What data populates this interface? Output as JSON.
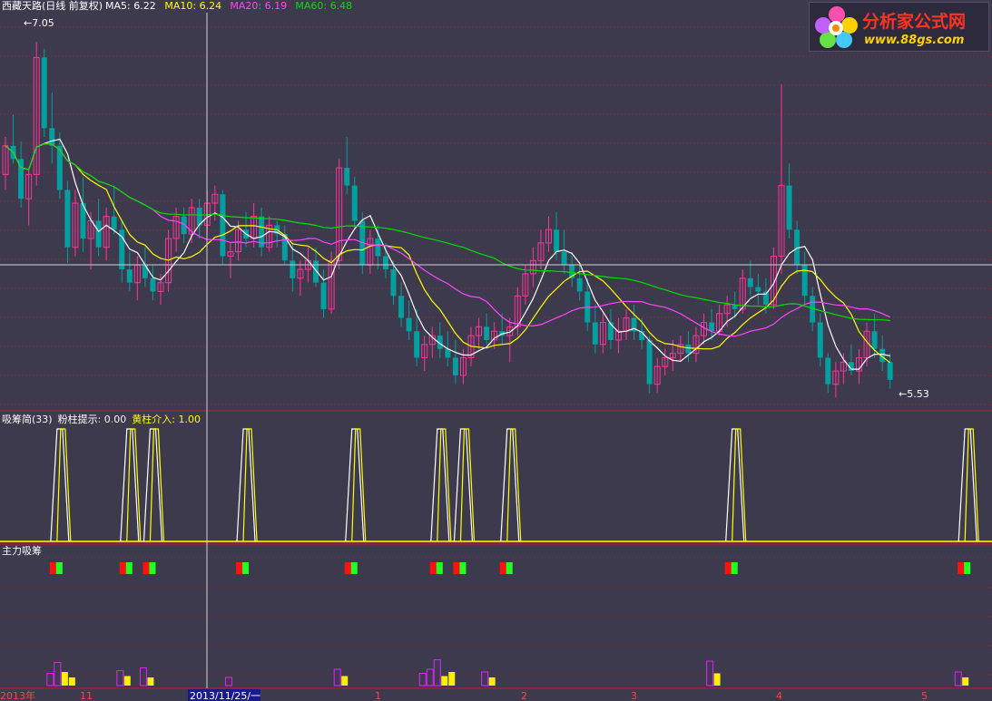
{
  "header": {
    "stock_name": "西藏天路",
    "adjust": "(日线 前复权)",
    "ma": [
      {
        "label": "MA5: ",
        "value": "6.22",
        "color": "#ffffff"
      },
      {
        "label": "MA10: ",
        "value": "6.24",
        "color": "#ffff00"
      },
      {
        "label": "MA20: ",
        "value": "6.19",
        "color": "#ff44ff"
      },
      {
        "label": "MA60: ",
        "value": "6.48",
        "color": "#00e000"
      }
    ]
  },
  "annotations": {
    "high": "7.05",
    "low": "5.53"
  },
  "indicator1": {
    "title": "吸筹简(33)",
    "pink_label": "粉柱提示: ",
    "pink_value": "0.00",
    "yellow_label": "黄柱介入: ",
    "yellow_value": "1.00"
  },
  "indicator2": {
    "title": "主力吸筹"
  },
  "date_axis": {
    "labels": [
      "2013年",
      "11",
      "2013/11/25/一",
      "1",
      "2",
      "3",
      "4",
      "5"
    ],
    "cursor_date": "2013/11/25/一"
  },
  "logo": {
    "line1": "分析家公式网",
    "line2": "www.88gs.com"
  },
  "colors": {
    "background": "#3e3a4e",
    "up_candle": "#ff3399",
    "down_candle": "#00a0a0",
    "ma5": "#ffffff",
    "ma10": "#ffff00",
    "ma20": "#ff44ff",
    "ma60": "#00e000",
    "grid": "#b0202a",
    "crosshair": "#d0d0d0"
  },
  "chart_data": {
    "type": "candlestick",
    "price_range": [
      5.4,
      7.15
    ],
    "candles": [
      [
        6.45,
        6.62,
        6.38,
        6.58
      ],
      [
        6.58,
        6.72,
        6.5,
        6.52
      ],
      [
        6.52,
        6.6,
        6.3,
        6.34
      ],
      [
        6.34,
        6.48,
        6.22,
        6.45
      ],
      [
        6.45,
        7.05,
        6.4,
        6.98
      ],
      [
        6.98,
        7.02,
        6.62,
        6.66
      ],
      [
        6.66,
        6.82,
        6.5,
        6.58
      ],
      [
        6.58,
        6.64,
        6.34,
        6.38
      ],
      [
        6.38,
        6.42,
        6.05,
        6.12
      ],
      [
        6.12,
        6.38,
        6.08,
        6.32
      ],
      [
        6.32,
        6.44,
        6.1,
        6.16
      ],
      [
        6.16,
        6.28,
        6.02,
        6.24
      ],
      [
        6.24,
        6.34,
        6.08,
        6.12
      ],
      [
        6.12,
        6.3,
        6.06,
        6.26
      ],
      [
        6.26,
        6.4,
        6.18,
        6.2
      ],
      [
        6.2,
        6.24,
        5.96,
        6.02
      ],
      [
        6.02,
        6.1,
        5.92,
        5.96
      ],
      [
        5.96,
        6.08,
        5.88,
        6.04
      ],
      [
        6.04,
        6.12,
        5.94,
        5.98
      ],
      [
        5.98,
        6.04,
        5.88,
        5.92
      ],
      [
        5.92,
        6.0,
        5.86,
        5.96
      ],
      [
        5.96,
        6.2,
        5.92,
        6.16
      ],
      [
        6.16,
        6.3,
        6.1,
        6.26
      ],
      [
        6.26,
        6.3,
        6.14,
        6.18
      ],
      [
        6.18,
        6.34,
        6.14,
        6.3
      ],
      [
        6.3,
        6.34,
        6.16,
        6.22
      ],
      [
        6.22,
        6.38,
        6.18,
        6.32
      ],
      [
        6.32,
        6.4,
        6.24,
        6.36
      ],
      [
        6.36,
        6.38,
        6.04,
        6.08
      ],
      [
        6.08,
        6.14,
        5.98,
        6.1
      ],
      [
        6.1,
        6.24,
        6.06,
        6.2
      ],
      [
        6.2,
        6.28,
        6.12,
        6.16
      ],
      [
        6.16,
        6.32,
        6.12,
        6.26
      ],
      [
        6.26,
        6.3,
        6.08,
        6.12
      ],
      [
        6.12,
        6.26,
        6.1,
        6.22
      ],
      [
        6.22,
        6.24,
        6.12,
        6.18
      ],
      [
        6.18,
        6.22,
        6.04,
        6.06
      ],
      [
        6.06,
        6.14,
        5.92,
        5.98
      ],
      [
        5.98,
        6.06,
        5.9,
        6.02
      ],
      [
        6.02,
        6.12,
        5.96,
        6.06
      ],
      [
        6.06,
        6.12,
        5.94,
        5.96
      ],
      [
        5.96,
        6.02,
        5.8,
        5.84
      ],
      [
        5.84,
        6.1,
        5.82,
        6.06
      ],
      [
        6.06,
        6.52,
        6.02,
        6.48
      ],
      [
        6.48,
        6.62,
        6.36,
        6.4
      ],
      [
        6.4,
        6.44,
        6.2,
        6.24
      ],
      [
        6.24,
        6.28,
        6.0,
        6.04
      ],
      [
        6.04,
        6.2,
        6.0,
        6.16
      ],
      [
        6.16,
        6.22,
        6.02,
        6.08
      ],
      [
        6.08,
        6.14,
        5.98,
        6.02
      ],
      [
        6.02,
        6.06,
        5.86,
        5.9
      ],
      [
        5.9,
        5.96,
        5.76,
        5.8
      ],
      [
        5.8,
        5.88,
        5.7,
        5.74
      ],
      [
        5.74,
        5.84,
        5.58,
        5.62
      ],
      [
        5.62,
        5.72,
        5.56,
        5.68
      ],
      [
        5.68,
        5.76,
        5.62,
        5.72
      ],
      [
        5.72,
        5.78,
        5.62,
        5.66
      ],
      [
        5.66,
        5.74,
        5.58,
        5.62
      ],
      [
        5.62,
        5.7,
        5.5,
        5.54
      ],
      [
        5.54,
        5.66,
        5.5,
        5.62
      ],
      [
        5.62,
        5.76,
        5.58,
        5.72
      ],
      [
        5.72,
        5.8,
        5.66,
        5.76
      ],
      [
        5.76,
        5.82,
        5.68,
        5.7
      ],
      [
        5.7,
        5.78,
        5.66,
        5.74
      ],
      [
        5.74,
        5.82,
        5.68,
        5.72
      ],
      [
        5.72,
        5.8,
        5.6,
        5.76
      ],
      [
        5.76,
        5.94,
        5.72,
        5.9
      ],
      [
        5.9,
        6.04,
        5.86,
        6.0
      ],
      [
        6.0,
        6.12,
        5.94,
        6.06
      ],
      [
        6.06,
        6.2,
        6.02,
        6.14
      ],
      [
        6.14,
        6.26,
        6.1,
        6.2
      ],
      [
        6.2,
        6.28,
        6.06,
        6.1
      ],
      [
        6.1,
        6.2,
        6.0,
        6.04
      ],
      [
        6.04,
        6.1,
        5.94,
        5.98
      ],
      [
        5.98,
        6.04,
        5.88,
        5.92
      ],
      [
        5.92,
        5.98,
        5.74,
        5.78
      ],
      [
        5.78,
        5.86,
        5.64,
        5.68
      ],
      [
        5.68,
        5.82,
        5.64,
        5.78
      ],
      [
        5.78,
        5.84,
        5.66,
        5.7
      ],
      [
        5.7,
        5.8,
        5.64,
        5.74
      ],
      [
        5.74,
        5.84,
        5.7,
        5.8
      ],
      [
        5.8,
        5.86,
        5.7,
        5.74
      ],
      [
        5.74,
        5.8,
        5.66,
        5.7
      ],
      [
        5.7,
        5.72,
        5.46,
        5.5
      ],
      [
        5.5,
        5.62,
        5.46,
        5.58
      ],
      [
        5.58,
        5.66,
        5.54,
        5.62
      ],
      [
        5.62,
        5.7,
        5.56,
        5.64
      ],
      [
        5.64,
        5.72,
        5.6,
        5.68
      ],
      [
        5.68,
        5.74,
        5.6,
        5.64
      ],
      [
        5.64,
        5.76,
        5.6,
        5.72
      ],
      [
        5.72,
        5.82,
        5.68,
        5.78
      ],
      [
        5.78,
        5.84,
        5.7,
        5.74
      ],
      [
        5.74,
        5.86,
        5.72,
        5.82
      ],
      [
        5.82,
        5.9,
        5.76,
        5.86
      ],
      [
        5.86,
        5.92,
        5.8,
        5.84
      ],
      [
        5.84,
        6.02,
        5.82,
        5.98
      ],
      [
        5.98,
        6.06,
        5.9,
        5.94
      ],
      [
        5.94,
        6.0,
        5.86,
        5.92
      ],
      [
        5.92,
        5.98,
        5.82,
        5.86
      ],
      [
        5.86,
        6.12,
        5.84,
        6.08
      ],
      [
        6.08,
        6.86,
        6.0,
        6.4
      ],
      [
        6.4,
        6.5,
        6.16,
        6.2
      ],
      [
        6.2,
        6.24,
        6.0,
        6.04
      ],
      [
        6.04,
        6.1,
        5.86,
        5.9
      ],
      [
        5.9,
        5.94,
        5.74,
        5.78
      ],
      [
        5.78,
        5.82,
        5.58,
        5.62
      ],
      [
        5.62,
        5.64,
        5.46,
        5.5
      ],
      [
        5.5,
        5.6,
        5.44,
        5.56
      ],
      [
        5.56,
        5.64,
        5.5,
        5.6
      ],
      [
        5.6,
        5.68,
        5.54,
        5.56
      ],
      [
        5.56,
        5.66,
        5.5,
        5.62
      ],
      [
        5.62,
        5.78,
        5.58,
        5.74
      ],
      [
        5.74,
        5.82,
        5.62,
        5.66
      ],
      [
        5.66,
        5.72,
        5.56,
        5.6
      ],
      [
        5.6,
        5.64,
        5.48,
        5.52
      ]
    ],
    "indicator_pulses": [
      7,
      16,
      19,
      31,
      45,
      56,
      59,
      65,
      94,
      124
    ],
    "red_markers": [
      7,
      16,
      19,
      31,
      45,
      56,
      59,
      65,
      94,
      124
    ],
    "bottom_bars": [
      {
        "i": 7,
        "magenta": [
          0.45,
          0.85
        ],
        "yellow": [
          0.5,
          0.3
        ]
      },
      {
        "i": 16,
        "magenta": [
          0.55
        ],
        "yellow": [
          0.35
        ]
      },
      {
        "i": 19,
        "magenta": [
          0.65
        ],
        "yellow": [
          0.3
        ]
      },
      {
        "i": 30,
        "magenta": [
          0.3
        ],
        "yellow": []
      },
      {
        "i": 44,
        "magenta": [
          0.6
        ],
        "yellow": [
          0.35
        ]
      },
      {
        "i": 55,
        "magenta": [
          0.45,
          0.6,
          0.95
        ],
        "yellow": [
          0.35,
          0.5
        ]
      },
      {
        "i": 63,
        "magenta": [
          0.5
        ],
        "yellow": [
          0.3
        ]
      },
      {
        "i": 92,
        "magenta": [
          0.9
        ],
        "yellow": [
          0.45
        ]
      },
      {
        "i": 124,
        "magenta": [
          0.5
        ],
        "yellow": [
          0.3
        ]
      }
    ]
  }
}
